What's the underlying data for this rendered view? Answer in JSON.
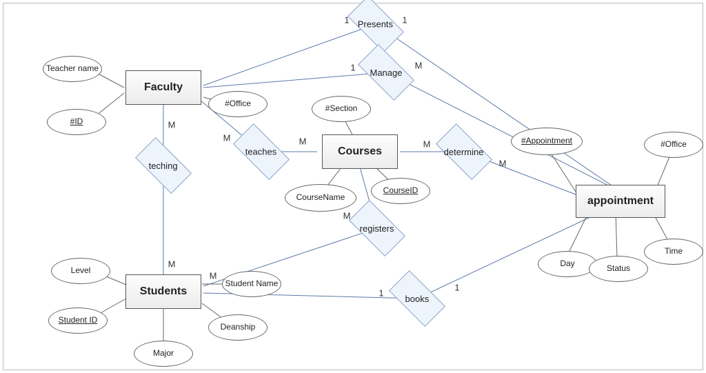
{
  "diagram": {
    "type": "ER",
    "entities": {
      "faculty": {
        "label": "Faculty",
        "attributes": {
          "teacher_name": "Teacher name",
          "id": "#ID",
          "office": "#Office"
        }
      },
      "students": {
        "label": "Students",
        "attributes": {
          "level": "Level",
          "student_id": "Student ID",
          "student_name": "Student Name",
          "deanship": "Deanship",
          "major": "Major"
        }
      },
      "courses": {
        "label": "Courses",
        "attributes": {
          "section": "#Section",
          "course_name": "CourseName",
          "course_id": "CourseID"
        }
      },
      "appointment": {
        "label": "appointment",
        "attributes": {
          "appt_no": "#Appointment",
          "office": "#Office",
          "day": "Day",
          "status": "Status",
          "time": "Time"
        }
      }
    },
    "relationships": {
      "presents": {
        "label": "Presents",
        "from": "faculty",
        "to": "appointment",
        "card_from": "1",
        "card_to": "1"
      },
      "manage": {
        "label": "Manage",
        "from": "faculty",
        "to": "appointment",
        "card_from": "1",
        "card_to": "M"
      },
      "teching": {
        "label": "teching",
        "from": "faculty",
        "to": "students",
        "card_from": "M",
        "card_to": "M"
      },
      "teaches": {
        "label": "teaches",
        "from": "faculty",
        "to": "courses",
        "card_from": "M",
        "card_to": "M"
      },
      "determine": {
        "label": "determine",
        "from": "courses",
        "to": "appointment",
        "card_from": "M",
        "card_to": "M"
      },
      "registers": {
        "label": "registers",
        "from": "students",
        "to": "courses",
        "card_from": "M",
        "card_to": "M"
      },
      "books": {
        "label": "books",
        "from": "students",
        "to": "appointment",
        "card_from": "1",
        "card_to": "1"
      }
    }
  }
}
